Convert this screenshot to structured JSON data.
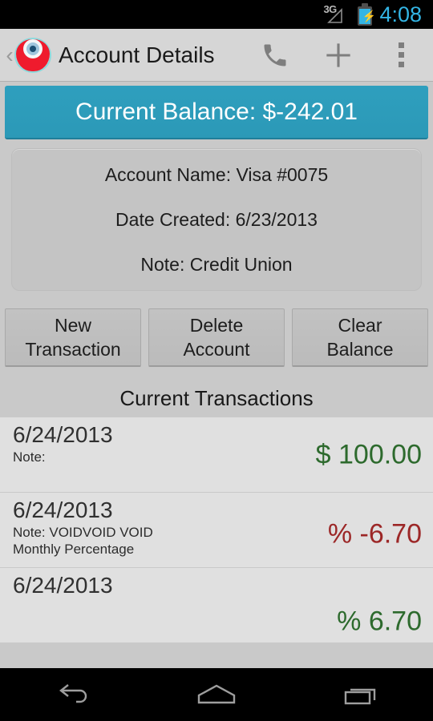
{
  "statusbar": {
    "network_label": "3G",
    "time": "4:08",
    "battery_state": "charging",
    "accent_color": "#33b5e5"
  },
  "actionbar": {
    "title": "Account Details",
    "up_label": "‹",
    "icons": [
      "call-icon",
      "add-icon",
      "overflow-menu-icon"
    ]
  },
  "balance_banner": {
    "text": "Current Balance: $-242.01",
    "background_color": "#2e9fbe",
    "text_color": "#ffffff"
  },
  "account_card": {
    "name_line": "Account Name:  Visa #0075",
    "date_line": "Date Created:   6/23/2013",
    "note_line": "Note:  Credit Union"
  },
  "buttons": {
    "new_transaction": "New\nTransaction",
    "delete_account": "Delete\nAccount",
    "clear_balance": "Clear\nBalance"
  },
  "transactions": {
    "header": "Current Transactions",
    "rows": [
      {
        "date": "6/24/2013",
        "note": "Note:",
        "amount": "$ 100.00",
        "sign": "positive"
      },
      {
        "date": "6/24/2013",
        "note": "Note: VOIDVOID  VOID\nMonthly Percentage",
        "amount": "% -6.70",
        "sign": "negative"
      },
      {
        "date": "6/24/2013",
        "note": "",
        "amount": "% 6.70",
        "sign": "positive"
      }
    ],
    "positive_color": "#2d6a2d",
    "negative_color": "#9c2727"
  },
  "navbar": {
    "back": "back-icon",
    "home": "home-icon",
    "recents": "recents-icon"
  }
}
